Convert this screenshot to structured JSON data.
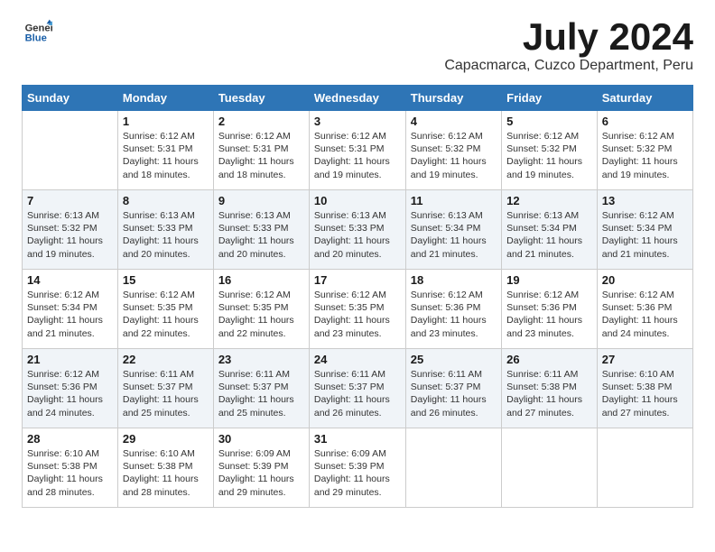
{
  "logo": {
    "general": "General",
    "blue": "Blue"
  },
  "title": {
    "month_year": "July 2024",
    "location": "Capacmarca, Cuzco Department, Peru"
  },
  "weekdays": [
    "Sunday",
    "Monday",
    "Tuesday",
    "Wednesday",
    "Thursday",
    "Friday",
    "Saturday"
  ],
  "weeks": [
    [
      {
        "day": "",
        "info": ""
      },
      {
        "day": "1",
        "info": "Sunrise: 6:12 AM\nSunset: 5:31 PM\nDaylight: 11 hours\nand 18 minutes."
      },
      {
        "day": "2",
        "info": "Sunrise: 6:12 AM\nSunset: 5:31 PM\nDaylight: 11 hours\nand 18 minutes."
      },
      {
        "day": "3",
        "info": "Sunrise: 6:12 AM\nSunset: 5:31 PM\nDaylight: 11 hours\nand 19 minutes."
      },
      {
        "day": "4",
        "info": "Sunrise: 6:12 AM\nSunset: 5:32 PM\nDaylight: 11 hours\nand 19 minutes."
      },
      {
        "day": "5",
        "info": "Sunrise: 6:12 AM\nSunset: 5:32 PM\nDaylight: 11 hours\nand 19 minutes."
      },
      {
        "day": "6",
        "info": "Sunrise: 6:12 AM\nSunset: 5:32 PM\nDaylight: 11 hours\nand 19 minutes."
      }
    ],
    [
      {
        "day": "7",
        "info": "Sunrise: 6:13 AM\nSunset: 5:32 PM\nDaylight: 11 hours\nand 19 minutes."
      },
      {
        "day": "8",
        "info": "Sunrise: 6:13 AM\nSunset: 5:33 PM\nDaylight: 11 hours\nand 20 minutes."
      },
      {
        "day": "9",
        "info": "Sunrise: 6:13 AM\nSunset: 5:33 PM\nDaylight: 11 hours\nand 20 minutes."
      },
      {
        "day": "10",
        "info": "Sunrise: 6:13 AM\nSunset: 5:33 PM\nDaylight: 11 hours\nand 20 minutes."
      },
      {
        "day": "11",
        "info": "Sunrise: 6:13 AM\nSunset: 5:34 PM\nDaylight: 11 hours\nand 21 minutes."
      },
      {
        "day": "12",
        "info": "Sunrise: 6:13 AM\nSunset: 5:34 PM\nDaylight: 11 hours\nand 21 minutes."
      },
      {
        "day": "13",
        "info": "Sunrise: 6:12 AM\nSunset: 5:34 PM\nDaylight: 11 hours\nand 21 minutes."
      }
    ],
    [
      {
        "day": "14",
        "info": "Sunrise: 6:12 AM\nSunset: 5:34 PM\nDaylight: 11 hours\nand 21 minutes."
      },
      {
        "day": "15",
        "info": "Sunrise: 6:12 AM\nSunset: 5:35 PM\nDaylight: 11 hours\nand 22 minutes."
      },
      {
        "day": "16",
        "info": "Sunrise: 6:12 AM\nSunset: 5:35 PM\nDaylight: 11 hours\nand 22 minutes."
      },
      {
        "day": "17",
        "info": "Sunrise: 6:12 AM\nSunset: 5:35 PM\nDaylight: 11 hours\nand 23 minutes."
      },
      {
        "day": "18",
        "info": "Sunrise: 6:12 AM\nSunset: 5:36 PM\nDaylight: 11 hours\nand 23 minutes."
      },
      {
        "day": "19",
        "info": "Sunrise: 6:12 AM\nSunset: 5:36 PM\nDaylight: 11 hours\nand 23 minutes."
      },
      {
        "day": "20",
        "info": "Sunrise: 6:12 AM\nSunset: 5:36 PM\nDaylight: 11 hours\nand 24 minutes."
      }
    ],
    [
      {
        "day": "21",
        "info": "Sunrise: 6:12 AM\nSunset: 5:36 PM\nDaylight: 11 hours\nand 24 minutes."
      },
      {
        "day": "22",
        "info": "Sunrise: 6:11 AM\nSunset: 5:37 PM\nDaylight: 11 hours\nand 25 minutes."
      },
      {
        "day": "23",
        "info": "Sunrise: 6:11 AM\nSunset: 5:37 PM\nDaylight: 11 hours\nand 25 minutes."
      },
      {
        "day": "24",
        "info": "Sunrise: 6:11 AM\nSunset: 5:37 PM\nDaylight: 11 hours\nand 26 minutes."
      },
      {
        "day": "25",
        "info": "Sunrise: 6:11 AM\nSunset: 5:37 PM\nDaylight: 11 hours\nand 26 minutes."
      },
      {
        "day": "26",
        "info": "Sunrise: 6:11 AM\nSunset: 5:38 PM\nDaylight: 11 hours\nand 27 minutes."
      },
      {
        "day": "27",
        "info": "Sunrise: 6:10 AM\nSunset: 5:38 PM\nDaylight: 11 hours\nand 27 minutes."
      }
    ],
    [
      {
        "day": "28",
        "info": "Sunrise: 6:10 AM\nSunset: 5:38 PM\nDaylight: 11 hours\nand 28 minutes."
      },
      {
        "day": "29",
        "info": "Sunrise: 6:10 AM\nSunset: 5:38 PM\nDaylight: 11 hours\nand 28 minutes."
      },
      {
        "day": "30",
        "info": "Sunrise: 6:09 AM\nSunset: 5:39 PM\nDaylight: 11 hours\nand 29 minutes."
      },
      {
        "day": "31",
        "info": "Sunrise: 6:09 AM\nSunset: 5:39 PM\nDaylight: 11 hours\nand 29 minutes."
      },
      {
        "day": "",
        "info": ""
      },
      {
        "day": "",
        "info": ""
      },
      {
        "day": "",
        "info": ""
      }
    ]
  ]
}
